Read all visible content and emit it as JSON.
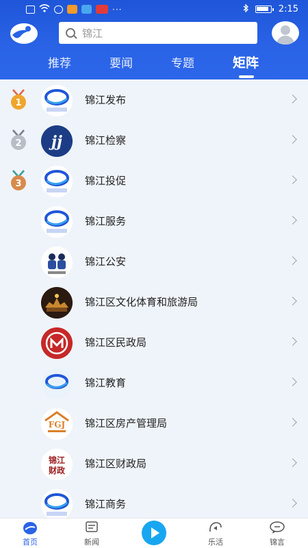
{
  "status_bar": {
    "time": "2:15"
  },
  "search": {
    "placeholder": "锦江"
  },
  "tabs": [
    {
      "label": "推荐"
    },
    {
      "label": "要闻"
    },
    {
      "label": "专题"
    },
    {
      "label": "矩阵"
    }
  ],
  "active_tab": "矩阵",
  "list": [
    {
      "label": "锦江发布",
      "rank": "1",
      "icon": "jinjiang-logo-icon"
    },
    {
      "label": "锦江检察",
      "rank": "2",
      "icon": "procuratorate-icon"
    },
    {
      "label": "锦江投促",
      "rank": "3",
      "icon": "jinjiang-logo-icon"
    },
    {
      "label": "锦江服务",
      "icon": "jinjiang-logo-icon"
    },
    {
      "label": "锦江公安",
      "icon": "police-icon"
    },
    {
      "label": "锦江区文化体育和旅游局",
      "icon": "culture-tourism-icon"
    },
    {
      "label": "锦江区民政局",
      "icon": "civil-affairs-icon"
    },
    {
      "label": "锦江教育",
      "icon": "education-icon"
    },
    {
      "label": "锦江区房产管理局",
      "icon": "fgj-icon"
    },
    {
      "label": "锦江区财政局",
      "icon": "finance-icon"
    },
    {
      "label": "锦江商务",
      "icon": "jinjiang-logo-icon"
    }
  ],
  "icon_text": {
    "fgj": "FGJ",
    "finance_line1": "锦江",
    "finance_line2": "财政",
    "procuratorate": "jj"
  },
  "bottom_nav": [
    {
      "label": "首页",
      "icon": "home-icon"
    },
    {
      "label": "新闻",
      "icon": "news-icon"
    },
    {
      "label": "",
      "icon": "play-icon"
    },
    {
      "label": "乐活",
      "icon": "lehuo-icon"
    },
    {
      "label": "锦言",
      "icon": "jinyan-icon"
    }
  ],
  "colors": {
    "brand_blue": "#2a63e6",
    "list_bg": "#eff4fa",
    "gold": "#f0a52b",
    "silver": "#b8bec6",
    "bronze": "#d98a4c",
    "play_accent": "#19a6f0"
  }
}
